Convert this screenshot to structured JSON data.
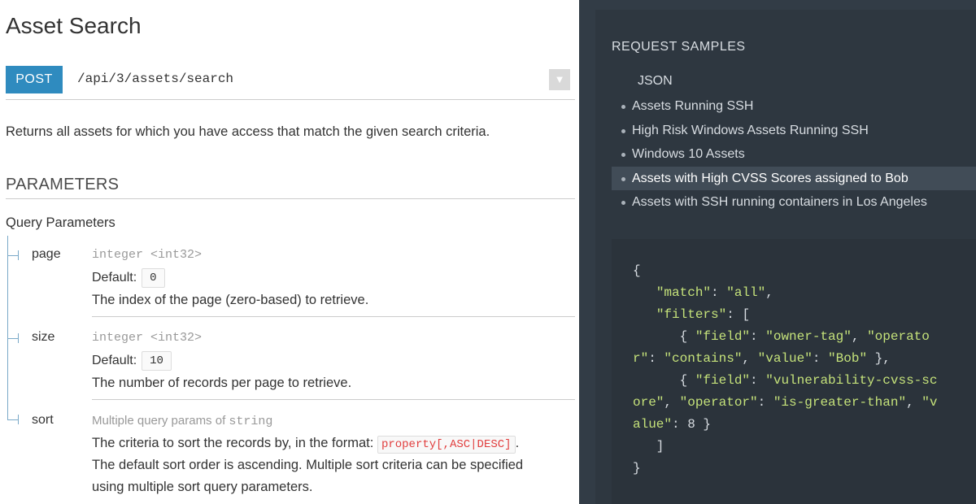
{
  "page": {
    "title": "Asset Search",
    "method": "POST",
    "path": "/api/3/assets/search",
    "description": "Returns all assets for which you have access that match the given search criteria.",
    "parameters_heading": "PARAMETERS",
    "query_heading": "Query Parameters"
  },
  "params": [
    {
      "name": "page",
      "type": "integer <int32>",
      "default_label": "Default:",
      "default_value": "0",
      "description": "The index of the page (zero-based) to retrieve."
    },
    {
      "name": "size",
      "type": "integer <int32>",
      "default_label": "Default:",
      "default_value": "10",
      "description": "The number of records per page to retrieve."
    },
    {
      "name": "sort",
      "type_prefix": "Multiple query params of",
      "type_mono": "string",
      "description_a": "The criteria to sort the records by, in the format:",
      "description_code": "property[,ASC|DESC]",
      "description_b": ".",
      "description_line2": "The default sort order is ascending. Multiple sort criteria can be specified",
      "description_line3": "using multiple sort query parameters."
    }
  ],
  "samples": {
    "title": "REQUEST SAMPLES",
    "format": "JSON",
    "items": [
      "Assets Running SSH",
      "High Risk Windows Assets Running SSH",
      "Windows 10 Assets",
      "Assets with High CVSS Scores assigned to Bob",
      "Assets with SSH running containers in Los Angeles"
    ],
    "active_index": 3
  },
  "code": {
    "line1": "{",
    "k_match": "\"match\"",
    "v_match": "\"all\"",
    "k_filters": "\"filters\"",
    "k_field": "\"field\"",
    "v_owner": "\"owner-tag\"",
    "k_operato": "\"operato",
    "k_r": "r\"",
    "v_contains": "\"contains\"",
    "k_value": "\"value\"",
    "v_bob": "\"Bob\"",
    "v_cvss_a": "\"vulnerability-cvss-sc",
    "v_cvss_b": "ore\"",
    "k_operator": "\"operator\"",
    "v_greater": "\"is-greater-than\"",
    "k_v": "\"v",
    "k_alue": "alue\"",
    "v_eight": "8"
  },
  "colors": {
    "post_button": "#2f8bbf",
    "dark_panel": "#323c46",
    "code_string": "#c5e27a",
    "inline_code": "#e13e3e"
  },
  "icons": [
    "chevron-down-icon"
  ]
}
